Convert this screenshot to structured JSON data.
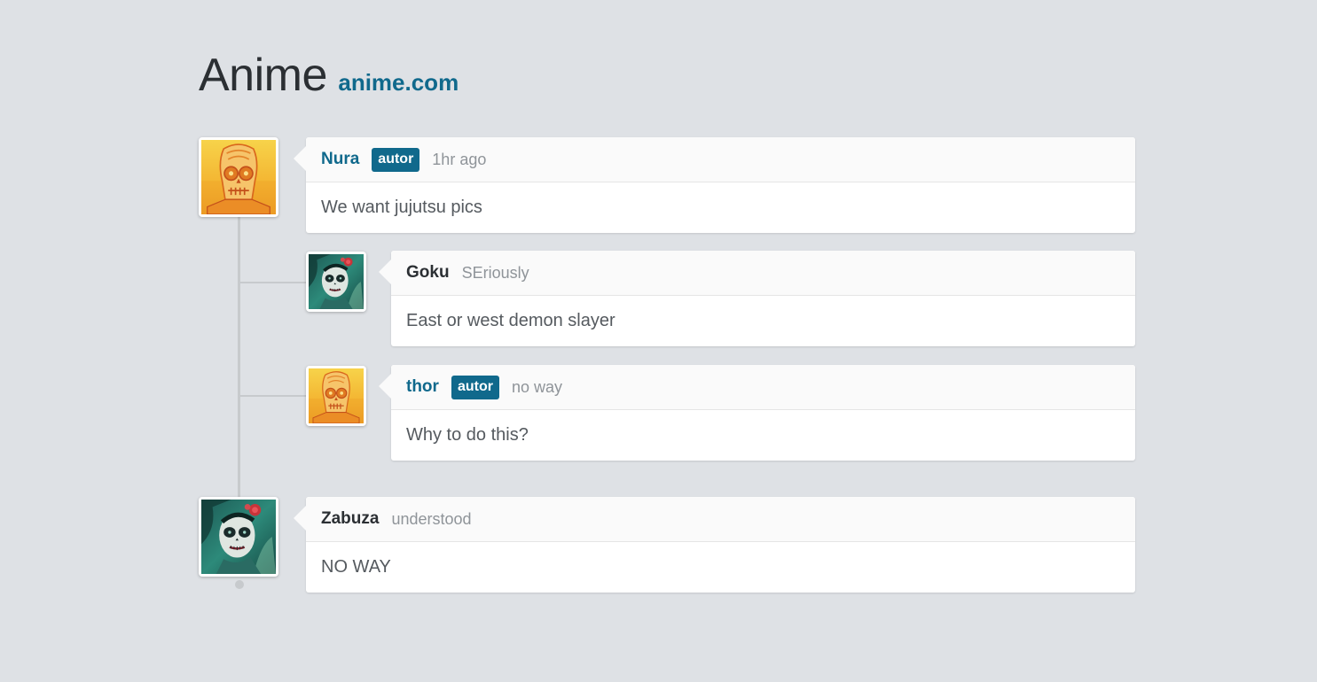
{
  "header": {
    "title": "Anime",
    "site_link": "anime.com"
  },
  "colors": {
    "accent": "#10698c",
    "background": "#dee1e5",
    "thread_line": "#c7cacd"
  },
  "comments": [
    {
      "name": "Nura",
      "is_author": true,
      "badge": "autor",
      "meta": "1hr ago",
      "body": "We want jujutsu pics",
      "avatar": "skull-avatar",
      "replies": [
        {
          "name": "Goku",
          "is_author": false,
          "meta": "SEriously",
          "body": "East or west demon slayer",
          "avatar": "catrina-avatar"
        },
        {
          "name": "thor",
          "is_author": true,
          "badge": "autor",
          "meta": "no way",
          "body": "Why to do this?",
          "avatar": "skull-avatar"
        }
      ]
    },
    {
      "name": "Zabuza",
      "is_author": false,
      "meta": "understood",
      "body": "NO WAY",
      "avatar": "catrina-avatar",
      "replies": []
    }
  ]
}
